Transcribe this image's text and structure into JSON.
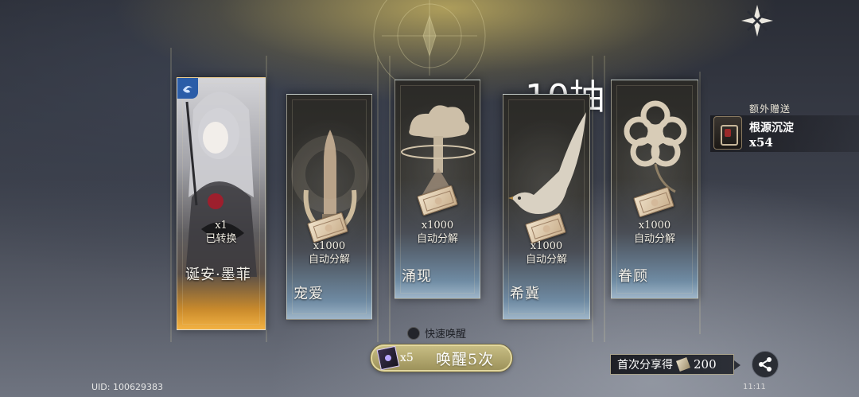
{
  "header": {
    "pull_count_label": "10抽"
  },
  "cards": [
    {
      "name": "诞安·墨菲",
      "qty": "x1",
      "status": "已转换",
      "kind": "character"
    },
    {
      "name": "宠爱",
      "qty": "x1000",
      "status": "自动分解",
      "kind": "item",
      "icon": "bullet-icon"
    },
    {
      "name": "涌现",
      "qty": "x1000",
      "status": "自动分解",
      "kind": "item",
      "icon": "mushroom-cloud-icon"
    },
    {
      "name": "希冀",
      "qty": "x1000",
      "status": "自动分解",
      "kind": "item",
      "icon": "dove-icon"
    },
    {
      "name": "眷顾",
      "qty": "x1000",
      "status": "自动分解",
      "kind": "item",
      "icon": "flower-icon"
    }
  ],
  "bonus": {
    "label": "额外赠送",
    "item_name": "根源沉淀",
    "count": "x54"
  },
  "quick_awaken": {
    "label": "快速唤醒",
    "enabled": false
  },
  "awaken_button": {
    "cost": "x5",
    "label": "唤醒5次"
  },
  "share_reward": {
    "label": "首次分享得",
    "amount": "200"
  },
  "footer": {
    "uid": "UID: 100629383",
    "time": "11:11"
  },
  "colors": {
    "accent_gold": "#c7bd83",
    "card_bottom_blue": "#9fb6c9",
    "character_glow": "#f3b243"
  }
}
